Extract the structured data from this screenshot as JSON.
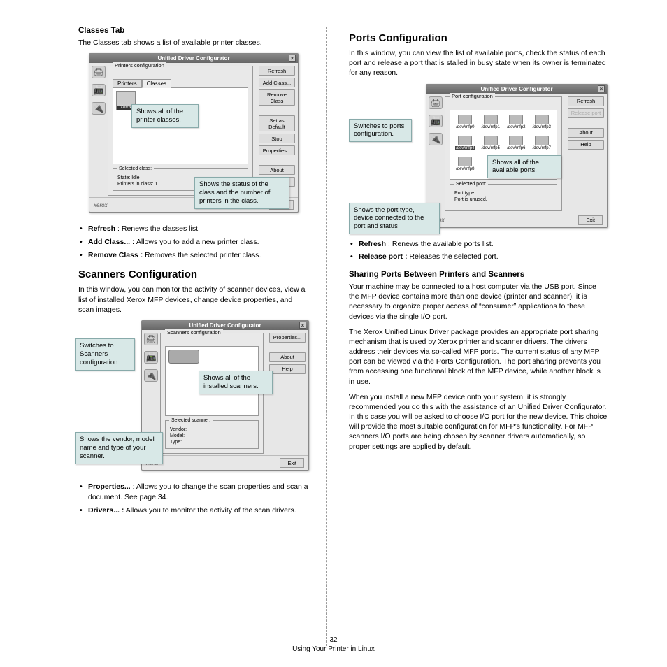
{
  "left": {
    "classes_heading": "Classes Tab",
    "classes_intro": "The Classes tab shows a list of available printer classes.",
    "classes_app": {
      "title": "Unified Driver Configurator",
      "group": "Printers configuration",
      "tab_printers": "Printers",
      "tab_classes": "Classes",
      "item_label": "Xerox",
      "buttons": {
        "refresh": "Refresh",
        "add_class": "Add Class...",
        "remove_class": "Remove Class",
        "set_default": "Set as Default",
        "stop": "Stop",
        "properties": "Properties...",
        "about": "About",
        "help": "Help"
      },
      "selected_title": "Selected class:",
      "selected_state": "State: Idle",
      "selected_count": "Printers in class: 1",
      "logo": "xerox",
      "exit": "Exit",
      "callout_list": "Shows all of the printer classes.",
      "callout_status": "Shows the status of the class and the number of printers in the class."
    },
    "classes_bullets": [
      {
        "b": "Refresh",
        "sep": " : ",
        "t": "Renews the classes list."
      },
      {
        "b": "Add Class... :",
        "sep": " ",
        "t": "Allows you to add a new printer class."
      },
      {
        "b": "Remove Class :",
        "sep": " ",
        "t": "Removes the selected printer class."
      }
    ],
    "scanners_heading": "Scanners Configuration",
    "scanners_intro": "In this window, you can monitor the activity of scanner devices, view a list of installed Xerox MFP devices, change device properties, and scan images.",
    "scanners_app": {
      "title": "Unified Driver Configurator",
      "group": "Scanners configuration",
      "buttons": {
        "properties": "Properties...",
        "about": "About",
        "help": "Help"
      },
      "selected_title": "Selected scanner:",
      "line_vendor": "Vendor:",
      "line_model": "Model:",
      "line_type": "Type:",
      "logo": "xerox",
      "exit": "Exit",
      "callout_switch": "Switches to Scanners configuration.",
      "callout_list": "Shows all of the installed scanners.",
      "callout_vendor": "Shows the vendor, model name and type of your scanner."
    },
    "scanners_bullets": [
      {
        "b": "Properties...",
        "sep": " : ",
        "t": "Allows you to change the scan properties and scan a document. See page 34."
      },
      {
        "b": "Drivers... :",
        "sep": " ",
        "t": "Allows you to monitor the activity of the scan drivers."
      }
    ]
  },
  "right": {
    "ports_heading": "Ports Configuration",
    "ports_intro": "In this window, you can view the list of available ports, check the status of each port and release a port that is stalled in busy state when its owner is terminated for any reason.",
    "ports_app": {
      "title": "Unified Driver Configurator",
      "group": "Port configuration",
      "ports": [
        "/dev/mfp0",
        "/dev/mfp1",
        "/dev/mfp2",
        "/dev/mfp3",
        "/dev/mfp4",
        "/dev/mfp5",
        "/dev/mfp6",
        "/dev/mfp7",
        "/dev/mfp8"
      ],
      "buttons": {
        "refresh": "Refresh",
        "release": "Release port",
        "about": "About",
        "help": "Help"
      },
      "selected_title": "Selected port:",
      "line_type": "Port type:",
      "line_status": "Port is unused.",
      "logo": "xerox",
      "exit": "Exit",
      "callout_switch": "Switches to ports configuration.",
      "callout_list": "Shows all of the available ports.",
      "callout_status": "Shows the port type, device connected to the port and status"
    },
    "ports_bullets": [
      {
        "b": "Refresh",
        "sep": " : ",
        "t": "Renews the available ports list."
      },
      {
        "b": "Release port :",
        "sep": " ",
        "t": "Releases the selected port."
      }
    ],
    "sharing_heading": "Sharing Ports Between Printers and Scanners",
    "sharing_p1": "Your machine may be connected to a host computer via the USB port. Since the MFP device contains more than one device (printer and scanner), it is necessary to organize proper access of “consumer” applications to these devices via the single I/O port.",
    "sharing_p2": "The Xerox Unified Linux Driver package provides an appropriate port sharing mechanism that is used by Xerox printer and scanner drivers. The drivers address their devices via so-called MFP ports. The current status of any MFP port can be viewed via the Ports Configuration. The port sharing prevents you from accessing one functional block of the MFP device, while another block is in use.",
    "sharing_p3": "When you install a new MFP device onto your system, it is strongly recommended you do this with the assistance of an Unified Driver Configurator. In this case you will be asked to choose I/O port for the new device. This choice will provide the most suitable configuration for MFP’s functionality. For MFP scanners I/O ports are being chosen by scanner drivers automatically, so proper settings are applied by default."
  },
  "footer": {
    "page_num": "32",
    "chapter": "Using Your Printer in Linux"
  }
}
